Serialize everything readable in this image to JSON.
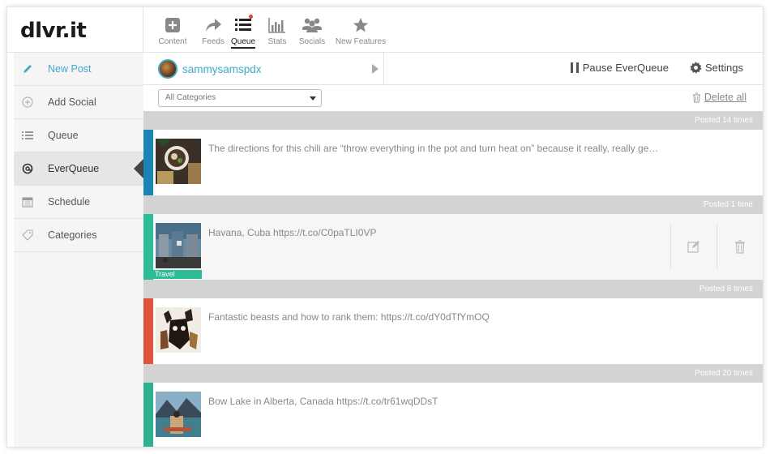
{
  "logo": "dlvr.it",
  "toolbar": [
    {
      "id": "content",
      "label": "Content",
      "icon": "plus-box-icon"
    },
    {
      "id": "feeds",
      "label": "Feeds",
      "icon": "share-arrow-icon"
    },
    {
      "id": "queue",
      "label": "Queue",
      "icon": "list-icon",
      "active": true
    },
    {
      "id": "stats",
      "label": "Stats",
      "icon": "bar-chart-icon"
    },
    {
      "id": "socials",
      "label": "Socials",
      "icon": "users-icon"
    },
    {
      "id": "new_features",
      "label": "New Features",
      "icon": "star-icon"
    }
  ],
  "sidebar": {
    "items": [
      {
        "label": "New Post",
        "icon": "pencil-icon"
      },
      {
        "label": "Add Social",
        "icon": "plus-circle-icon"
      },
      {
        "label": "Queue",
        "icon": "list-icon"
      },
      {
        "label": "EverQueue",
        "icon": "at-icon",
        "active": true
      },
      {
        "label": "Schedule",
        "icon": "calendar-icon"
      },
      {
        "label": "Categories",
        "icon": "tag-icon"
      }
    ]
  },
  "account": {
    "name": "sammysamspdx"
  },
  "controls": {
    "pause_label": "Pause EverQueue",
    "settings_label": "Settings"
  },
  "filter": {
    "selected": "All Categories",
    "delete_all": "Delete all"
  },
  "posts": [
    {
      "posted": "Posted 14 times",
      "text": "The directions for this chili are “throw everything in the pot and turn heat on” because it really, really ge…",
      "color": "#1a84b4"
    },
    {
      "posted": "Posted 1 time",
      "text": "Havana, Cuba https://t.co/C0paTLI0VP",
      "category": "Travel",
      "color": "#2dbd96"
    },
    {
      "posted": "Posted 8 times",
      "text": "Fantastic beasts and how to rank them: https://t.co/dY0dTfYmOQ",
      "color": "#e0533a"
    },
    {
      "posted": "Posted 20 times",
      "text": "Bow Lake in Alberta, Canada https://t.co/tr61wqDDsT",
      "color": "#2db08e"
    }
  ]
}
